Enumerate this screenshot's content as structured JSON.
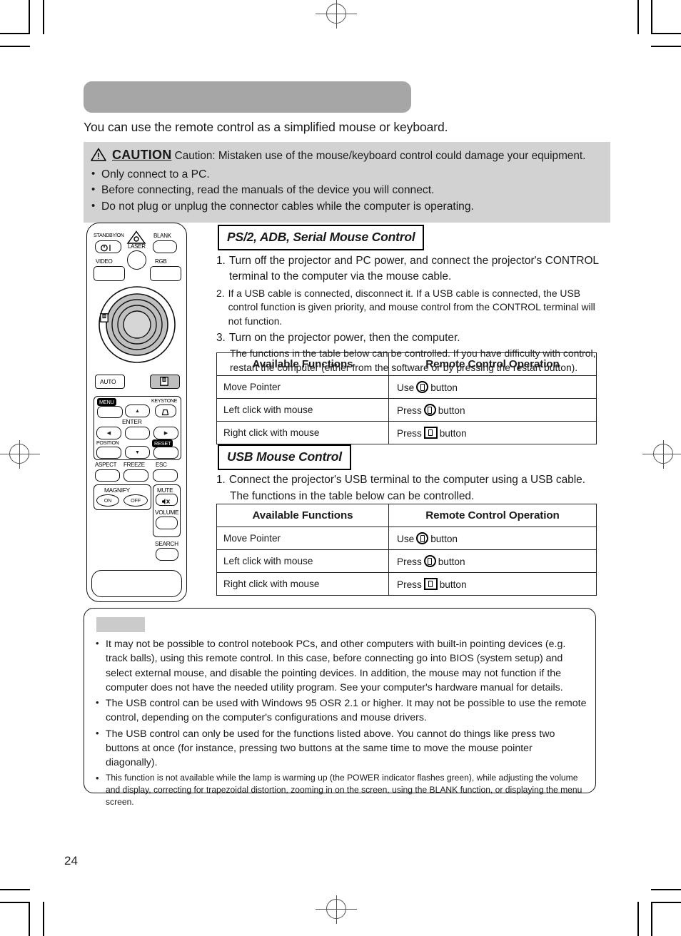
{
  "page_number": "24",
  "banner": {
    "text": ""
  },
  "intro": "You can use the remote control as a simplified mouse or keyboard.",
  "caution": {
    "word": "CAUTION",
    "rest": "Caution: Mistaken use of the mouse/keyboard control could damage your equipment.",
    "bullets": [
      "Only connect to a PC.",
      "Before connecting, read the manuals of the device you will connect.",
      "Do not plug or unplug the connector cables while the computer is operating."
    ]
  },
  "remote": {
    "labels": {
      "standby": "STANDBY/ON",
      "laser": "LASER",
      "blank": "BLANK",
      "video": "VIDEO",
      "rgb": "RGB",
      "auto": "AUTO",
      "menu": "MENU",
      "keystone": "KEYSTONE",
      "enter": "ENTER",
      "position": "POSITION",
      "reset": "RESET",
      "aspect": "ASPECT",
      "freeze": "FREEZE",
      "esc": "ESC",
      "magnify": "MAGNIFY",
      "magnify_on": "ON",
      "magnify_off": "OFF",
      "mute": "MUTE",
      "volume": "VOLUME",
      "search": "SEARCH"
    }
  },
  "section_ps2": {
    "title": "PS/2, ADB, Serial Mouse Control",
    "steps": [
      {
        "n": "1.",
        "text": "Turn off the projector and PC power, and connect the projector's CONTROL terminal to the computer via the mouse cable.",
        "size": "big"
      },
      {
        "n": "2.",
        "text": "If a USB cable is connected, disconnect it. If a USB cable is connected, the USB control function is given priority, and mouse control from the CONTROL terminal will not function.",
        "size": "small"
      },
      {
        "n": "3.",
        "text": "Turn on the projector power, then the computer.",
        "size": "big"
      }
    ],
    "step3_sub": "The functions in the table below can be controlled. If you have difficulty with control, restart the computer (either from the software or by pressing the restart button)."
  },
  "section_usb": {
    "title": "USB Mouse Control",
    "steps": [
      {
        "n": "1.",
        "text": "Connect the projector's USB terminal to the computer using a USB cable.",
        "size": "big"
      }
    ],
    "step1_sub": "The functions in the table below can be controlled."
  },
  "table": {
    "headers": [
      "Available Functions",
      "Remote Control Operation"
    ],
    "rows": [
      {
        "function": "Move Pointer",
        "verb": "Use",
        "icon": "disc-mouse-icon",
        "suffix": "button"
      },
      {
        "function": "Left click with mouse",
        "verb": "Press",
        "icon": "disc-mouse-icon",
        "suffix": "button"
      },
      {
        "function": "Right click with mouse",
        "verb": "Press",
        "icon": "rect-mouse-icon",
        "suffix": "button"
      }
    ]
  },
  "notes": {
    "placeholder": "",
    "items": [
      {
        "text": "It may not be possible to control notebook PCs, and other computers with built-in pointing devices (e.g. track balls), using this remote control. In this case, before connecting go into BIOS (system setup) and select external mouse, and disable the pointing devices. In addition, the mouse may not function if the computer does not have the needed utility program. See your computer's hardware manual for details.",
        "size": "large"
      },
      {
        "text": "The USB control can be used with Windows 95 OSR 2.1 or higher. It may not be possible to use the remote control, depending on the computer's configurations and mouse drivers.",
        "size": "large"
      },
      {
        "text": "The USB control can only be used for the functions listed above. You cannot do things like press two buttons at once (for instance, pressing two buttons at the same time to move the mouse pointer diagonally).",
        "size": "large"
      },
      {
        "text": "This function is not available while the lamp is warming up (the POWER indicator flashes green), while adjusting the volume and display, correcting for trapezoidal distortion, zooming in on the screen, using the BLANK function, or displaying the menu screen.",
        "size": "small"
      }
    ]
  },
  "colors": {
    "banner_gray": "#a6a6a6",
    "caution_gray": "#d2d2d2",
    "placeholder_gray": "#cbcbcb"
  }
}
